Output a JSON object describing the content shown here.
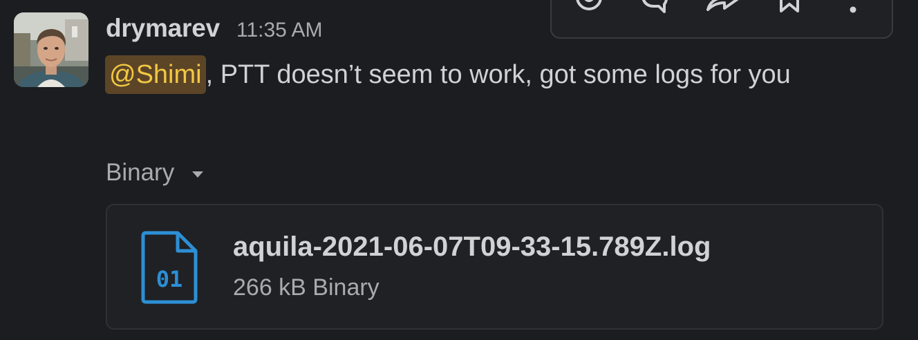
{
  "message": {
    "author": "drymarev",
    "timestamp": "11:35 AM",
    "mention": "@Shimi",
    "text": ", PTT doesn’t seem to work, got some logs for you"
  },
  "attachment": {
    "type_label": "Binary",
    "file_name": "aquila-2021-06-07T09-33-15.789Z.log",
    "file_meta": "266 kB Binary",
    "icon_text": "01"
  },
  "toolbar": {
    "icons": [
      "emoji-reaction-icon",
      "reply-in-thread-icon",
      "share-message-icon",
      "bookmark-icon",
      "more-actions-icon"
    ]
  },
  "colors": {
    "background": "#1b1d21",
    "text": "#d1d2d3",
    "muted": "#ababad",
    "mention_bg": "#5c4526",
    "mention_fg": "#f2c744",
    "file_icon": "#2d8fd5"
  }
}
